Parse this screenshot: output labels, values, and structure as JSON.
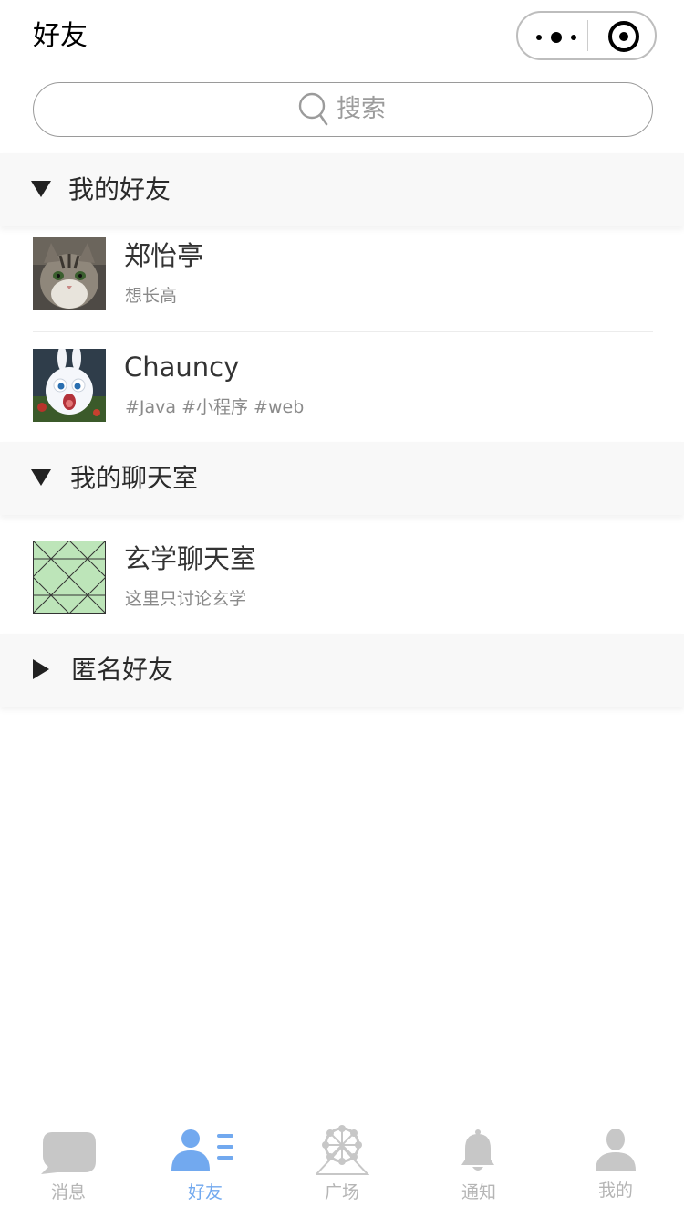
{
  "nav": {
    "title": "好友"
  },
  "search": {
    "placeholder": "搜索"
  },
  "groups": [
    {
      "title": "我的好友",
      "expanded": true,
      "items": [
        {
          "name": "郑怡亭",
          "subtitle": "想长高",
          "avatar": "cat-photo"
        },
        {
          "name": "Chauncy",
          "subtitle": "#Java #小程序 #web",
          "avatar": "white-rabbit-photo"
        }
      ]
    },
    {
      "title": "我的聊天室",
      "expanded": true,
      "items": [
        {
          "name": "玄学聊天室",
          "subtitle": "这里只讨论玄学",
          "avatar": "placeholder-image"
        }
      ]
    },
    {
      "title": "匿名好友",
      "expanded": false,
      "items": []
    }
  ],
  "tabbar": {
    "active_color": "#72a9ef",
    "inactive_color": "#b5b5b5",
    "tabs": [
      {
        "label": "消息",
        "icon": "chat-bubble-icon",
        "active": false
      },
      {
        "label": "好友",
        "icon": "friends-icon",
        "active": true
      },
      {
        "label": "广场",
        "icon": "ferris-wheel-icon",
        "active": false
      },
      {
        "label": "通知",
        "icon": "bell-icon",
        "active": false
      },
      {
        "label": "我的",
        "icon": "person-icon",
        "active": false
      }
    ]
  }
}
